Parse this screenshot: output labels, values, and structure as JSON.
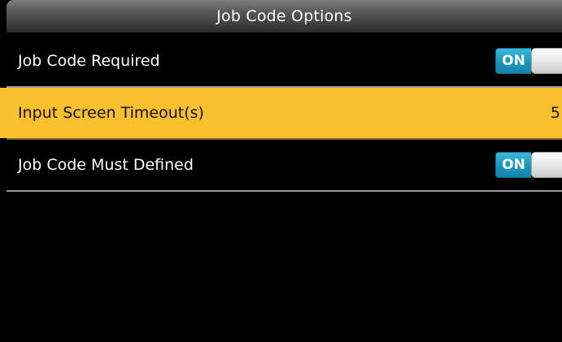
{
  "header": {
    "title": "Job Code Options"
  },
  "options": [
    {
      "label": "Job Code Required",
      "control": "toggle",
      "value": "ON"
    },
    {
      "label": "Input Screen Timeout(s)",
      "control": "value",
      "value": "5",
      "selected": true
    },
    {
      "label": "Job Code Must Defined",
      "control": "toggle",
      "value": "ON"
    }
  ],
  "colors": {
    "background": "#000000",
    "selected_row": "#fbc02d",
    "toggle_on": "#1c98be",
    "text": "#ffffff"
  }
}
